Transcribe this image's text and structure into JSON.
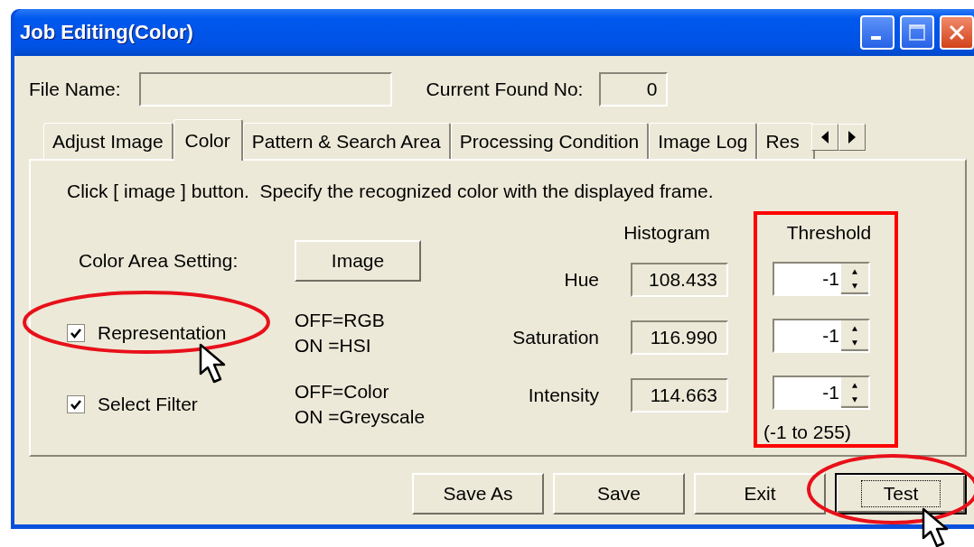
{
  "window": {
    "title": "Job Editing(Color)"
  },
  "file_name": {
    "label": "File Name:"
  },
  "current_found_no": {
    "label": "Current Found No:",
    "value": "0"
  },
  "tabs": [
    {
      "label": "Adjust Image",
      "selected": false
    },
    {
      "label": "Color",
      "selected": true
    },
    {
      "label": "Pattern & Search Area",
      "selected": false
    },
    {
      "label": "Processing Condition",
      "selected": false
    },
    {
      "label": "Image Log",
      "selected": false
    },
    {
      "label": "Res",
      "selected": false
    }
  ],
  "instruction": "Click [ image ] button.  Specify the recognized color with the displayed frame.",
  "color_area_setting": {
    "label": "Color Area Setting:",
    "button": "Image"
  },
  "options": [
    {
      "label": "Representation",
      "checked": true,
      "hint": [
        "OFF=RGB",
        "ON =HSI"
      ]
    },
    {
      "label": "Select Filter",
      "checked": true,
      "hint": [
        "OFF=Color",
        "ON =Greyscale"
      ]
    }
  ],
  "histogram": {
    "header": "Histogram"
  },
  "threshold": {
    "header": "Threshold",
    "range": "(-1 to 255)"
  },
  "channels": [
    {
      "name": "Hue",
      "histogram": "108.433",
      "threshold": "-1"
    },
    {
      "name": "Saturation",
      "histogram": "116.990",
      "threshold": "-1"
    },
    {
      "name": "Intensity",
      "histogram": "114.663",
      "threshold": "-1"
    }
  ],
  "buttons": [
    {
      "label": "Save As",
      "default": false
    },
    {
      "label": "Save",
      "default": false
    },
    {
      "label": "Exit",
      "default": false
    },
    {
      "label": "Test",
      "default": true
    }
  ]
}
